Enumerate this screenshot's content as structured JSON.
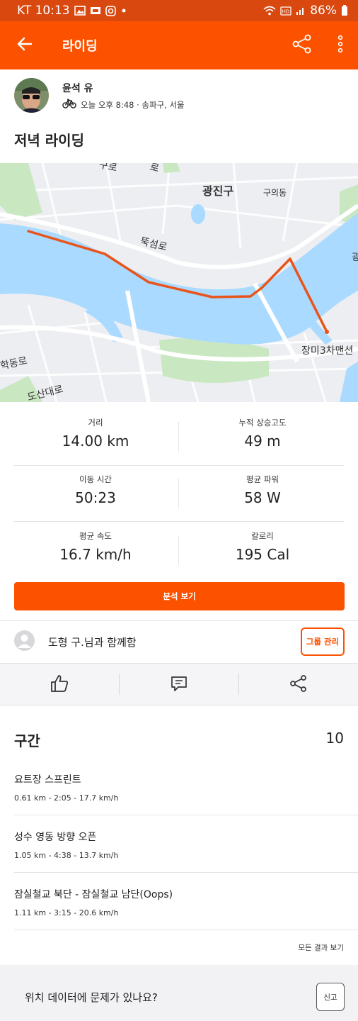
{
  "status_bar": {
    "carrier_time": "KT 10:13",
    "battery": "86%",
    "icons": [
      "photo-icon",
      "media-icon",
      "instagram-icon",
      "dot-icon",
      "wifi-icon",
      "hd-icon",
      "signal-icon",
      "battery-icon"
    ]
  },
  "app_bar": {
    "title": "라이딩",
    "icons": [
      "back-arrow-icon",
      "share-icon",
      "more-vertical-icon"
    ]
  },
  "activity": {
    "athlete_name": "윤석 유",
    "meta": "오늘 오후 8:48 · 송파구, 서울",
    "sport_icon": "bike-icon",
    "title": "저녁 라이딩"
  },
  "map": {
    "labels": {
      "gwangjin": "광진구",
      "guui": "구의동",
      "ttukseom": "뚝섬로",
      "jangmi": "장미3차맨션",
      "hakdong": "학동로",
      "dosan": "도산대로",
      "gwang_edge": "광",
      "road_top": "구로",
      "road_top2": "로"
    },
    "route_color": "#e8541c",
    "water_color": "#aadaff"
  },
  "stats": [
    {
      "label": "거리",
      "value": "14.00 km"
    },
    {
      "label": "누적 상승고도",
      "value": "49 m"
    },
    {
      "label": "이동 시간",
      "value": "50:23"
    },
    {
      "label": "평균 파워",
      "value": "58 W"
    },
    {
      "label": "평균 속도",
      "value": "16.7 km/h"
    },
    {
      "label": "칼로리",
      "value": "195 Cal"
    }
  ],
  "analysis_button": "분석 보기",
  "group": {
    "text": "도형 구.님과 함께함",
    "button": "그룹 관리"
  },
  "action_icons": [
    "thumbs-up-icon",
    "comment-icon",
    "share-icon"
  ],
  "segments": {
    "title": "구간",
    "count": "10",
    "items": [
      {
        "name": "요트장 스프린트",
        "detail": "0.61 km - 2:05 - 17.7 km/h"
      },
      {
        "name": "성수 영동 방향 오픈",
        "detail": "1.05 km - 4:38 - 13.7 km/h"
      },
      {
        "name": "잠실철교 북단 - 잠실철교 남단(Oops)",
        "detail": "1.11 km - 3:15 - 20.6 km/h"
      }
    ],
    "all_results": "모든 결과 보기"
  },
  "report": {
    "text": "위치 데이터에 문제가 있나요?",
    "button": "신고"
  },
  "colors": {
    "brand": "#fc5200",
    "status_bar": "#d9480f"
  }
}
